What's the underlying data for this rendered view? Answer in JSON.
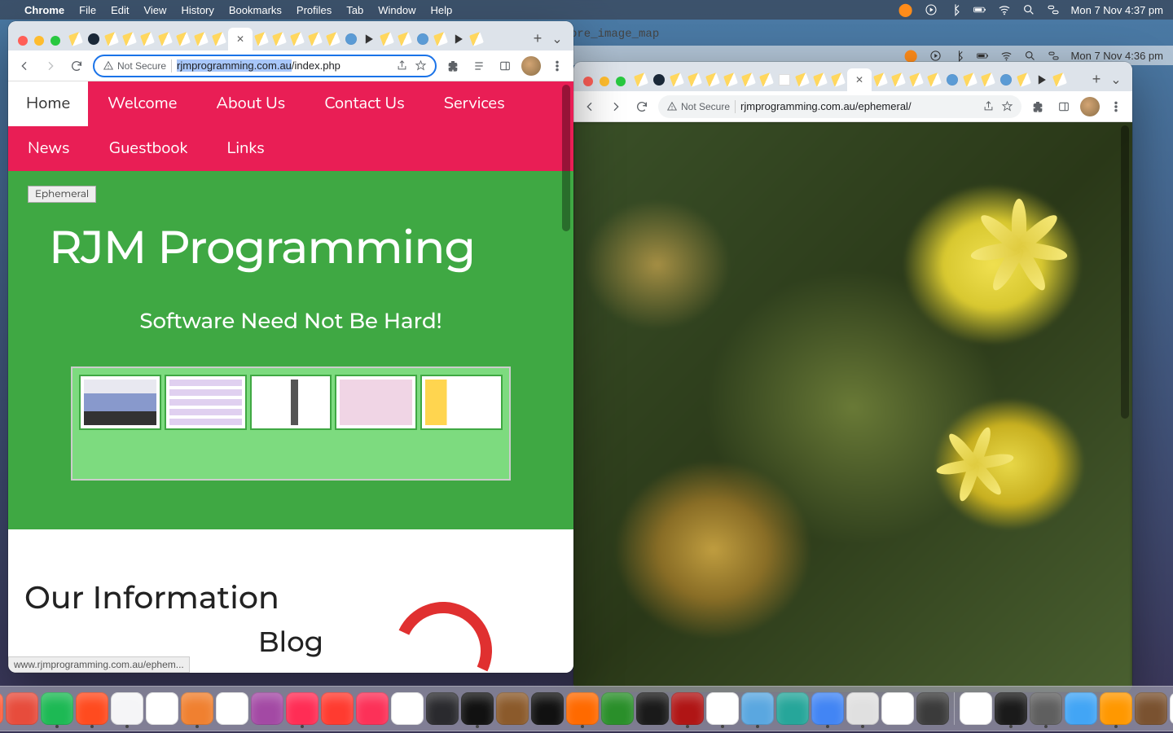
{
  "menubar_top": {
    "app": "Chrome",
    "items": [
      "File",
      "Edit",
      "View",
      "History",
      "Bookmarks",
      "Profiles",
      "Tab",
      "Window",
      "Help"
    ],
    "clock": "Mon 7 Nov  4:37 pm"
  },
  "menubar_right_window": {
    "clock": "Mon 7 Nov  4:36 pm"
  },
  "bg_fragment": "ore_image_map",
  "window_left": {
    "omnibox": {
      "not_secure": "Not Secure",
      "url_selected": "rjmprogramming.com.au",
      "url_rest": "/index.php"
    },
    "site_nav": {
      "home": "Home",
      "items": [
        "Welcome",
        "About Us",
        "Contact Us",
        "Services",
        "News",
        "Guestbook",
        "Links"
      ]
    },
    "hero": {
      "badge": "Ephemeral",
      "title": "RJM Programming",
      "subtitle": "Software Need Not Be Hard!"
    },
    "info": {
      "heading": "Our Information",
      "subheading": "Blog"
    },
    "status_bar": "www.rjmprogramming.com.au/ephem..."
  },
  "window_right": {
    "omnibox": {
      "not_secure": "Not Secure",
      "url": "rjmprogramming.com.au/ephemeral/"
    }
  },
  "tabs_left": [
    {
      "fav": "pencil"
    },
    {
      "fav": "dark"
    },
    {
      "fav": "pencil"
    },
    {
      "fav": "pencil"
    },
    {
      "fav": "pencil"
    },
    {
      "fav": "pencil"
    },
    {
      "fav": "pencil"
    },
    {
      "fav": "pencil"
    },
    {
      "fav": "pencil"
    },
    {
      "fav": "pencil",
      "active": true
    },
    {
      "fav": "pencil"
    },
    {
      "fav": "pencil"
    },
    {
      "fav": "pencil"
    },
    {
      "fav": "pencil"
    },
    {
      "fav": "pencil"
    },
    {
      "fav": "globe"
    },
    {
      "fav": "play"
    },
    {
      "fav": "pencil"
    },
    {
      "fav": "pencil"
    },
    {
      "fav": "globe"
    },
    {
      "fav": "pencil"
    },
    {
      "fav": "play"
    },
    {
      "fav": "pencil"
    }
  ],
  "tabs_right": [
    {
      "fav": "pencil"
    },
    {
      "fav": "dark"
    },
    {
      "fav": "pencil"
    },
    {
      "fav": "pencil"
    },
    {
      "fav": "pencil"
    },
    {
      "fav": "pencil"
    },
    {
      "fav": "pencil"
    },
    {
      "fav": "pencil"
    },
    {
      "fav": "white"
    },
    {
      "fav": "pencil"
    },
    {
      "fav": "pencil"
    },
    {
      "fav": "pencil"
    },
    {
      "fav": "pencil",
      "active": true
    },
    {
      "fav": "pencil"
    },
    {
      "fav": "pencil"
    },
    {
      "fav": "pencil"
    },
    {
      "fav": "pencil"
    },
    {
      "fav": "globe"
    },
    {
      "fav": "pencil"
    },
    {
      "fav": "pencil"
    },
    {
      "fav": "globe"
    },
    {
      "fav": "pencil"
    },
    {
      "fav": "play"
    },
    {
      "fav": "pencil"
    }
  ],
  "dock_icons": [
    {
      "c": "#2b67f6",
      "r": true
    },
    {
      "c": "#f0f0f0"
    },
    {
      "c": "#1fa1f2",
      "r": true
    },
    {
      "c": "#27c840",
      "r": true
    },
    {
      "c": "#f7c544",
      "r": true
    },
    {
      "c": "#ff5e3a",
      "r": true
    },
    {
      "c": "#e74c3c"
    },
    {
      "c": "#1db954",
      "r": true
    },
    {
      "c": "#ff4b1f",
      "r": true
    },
    {
      "c": "#f5f5f7",
      "r": true
    },
    {
      "c": "#ffffff"
    },
    {
      "c": "#f08030",
      "r": true
    },
    {
      "c": "#ffffff"
    },
    {
      "c": "#a349a4"
    },
    {
      "c": "#ff2d55",
      "r": true
    },
    {
      "c": "#ff3b30"
    },
    {
      "c": "#fc3158"
    },
    {
      "c": "#ffffff"
    },
    {
      "c": "#2a2a2e"
    },
    {
      "c": "#111111",
      "r": true
    },
    {
      "c": "#8b5a2b"
    },
    {
      "c": "#111111"
    },
    {
      "c": "#ff6a00",
      "r": true
    },
    {
      "c": "#2a8f2a"
    },
    {
      "c": "#1a1a1a"
    },
    {
      "c": "#b01515",
      "r": true
    },
    {
      "c": "#ffffff",
      "r": true
    },
    {
      "c": "#5aa7e0",
      "r": true
    },
    {
      "c": "#26a69a"
    },
    {
      "c": "#4285f4",
      "r": true
    },
    {
      "c": "#e0e0e0",
      "r": true
    },
    {
      "c": "#ffffff"
    },
    {
      "c": "#3b3b3b"
    },
    {
      "sep": true
    },
    {
      "c": "#ffffff"
    },
    {
      "c": "#1a1a1a",
      "r": true
    },
    {
      "c": "#5f5f5f",
      "r": true
    },
    {
      "c": "#42a5f5"
    },
    {
      "c": "#ff9800",
      "r": true
    },
    {
      "c": "#7a5230"
    },
    {
      "c": "#ffffff"
    },
    {
      "c": "#9ccc65"
    },
    {
      "c": "#555555"
    },
    {
      "c": "#d0d0d0"
    },
    {
      "c": "#888888"
    },
    {
      "c": "#d0d0d0"
    }
  ]
}
